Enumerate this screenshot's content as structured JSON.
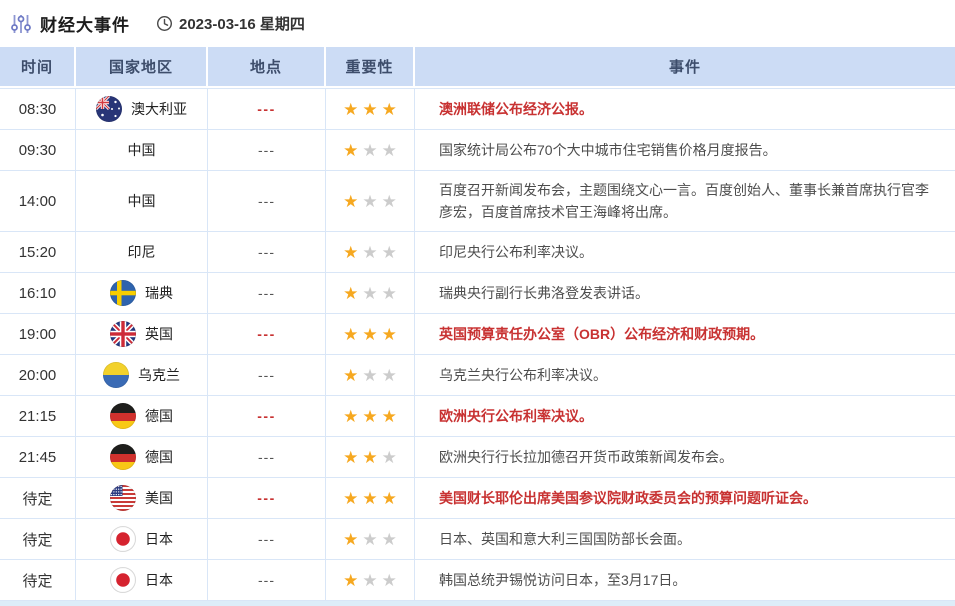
{
  "header": {
    "title": "财经大事件",
    "title_icon": "sliders-icon",
    "date_icon": "clock-icon",
    "date": "2023-03-16 星期四"
  },
  "table": {
    "columns": [
      "时间",
      "国家地区",
      "地点",
      "重要性",
      "事件"
    ],
    "max_stars": 3,
    "rows": [
      {
        "time": "08:30",
        "country": "澳大利亚",
        "flag": "australia",
        "location": "---",
        "stars": 3,
        "highlight": true,
        "event": "澳洲联储公布经济公报。"
      },
      {
        "time": "09:30",
        "country": "中国",
        "flag": null,
        "location": "---",
        "stars": 1,
        "highlight": false,
        "event": "国家统计局公布70个大中城市住宅销售价格月度报告。"
      },
      {
        "time": "14:00",
        "country": "中国",
        "flag": null,
        "location": "---",
        "stars": 1,
        "highlight": false,
        "event": "百度召开新闻发布会，主题围绕文心一言。百度创始人、董事长兼首席执行官李彦宏，百度首席技术官王海峰将出席。"
      },
      {
        "time": "15:20",
        "country": "印尼",
        "flag": null,
        "location": "---",
        "stars": 1,
        "highlight": false,
        "event": "印尼央行公布利率决议。"
      },
      {
        "time": "16:10",
        "country": "瑞典",
        "flag": "sweden",
        "location": "---",
        "stars": 1,
        "highlight": false,
        "event": "瑞典央行副行长弗洛登发表讲话。"
      },
      {
        "time": "19:00",
        "country": "英国",
        "flag": "uk",
        "location": "---",
        "stars": 3,
        "highlight": true,
        "event": "英国预算责任办公室（OBR）公布经济和财政预期。"
      },
      {
        "time": "20:00",
        "country": "乌克兰",
        "flag": "ukraine",
        "location": "---",
        "stars": 1,
        "highlight": false,
        "event": "乌克兰央行公布利率决议。"
      },
      {
        "time": "21:15",
        "country": "德国",
        "flag": "germany",
        "location": "---",
        "stars": 3,
        "highlight": true,
        "event": "欧洲央行公布利率决议。"
      },
      {
        "time": "21:45",
        "country": "德国",
        "flag": "germany",
        "location": "---",
        "stars": 2,
        "highlight": false,
        "event": "欧洲央行行长拉加德召开货币政策新闻发布会。"
      },
      {
        "time": "待定",
        "country": "美国",
        "flag": "usa",
        "location": "---",
        "stars": 3,
        "highlight": true,
        "event": "美国财长耶伦出席美国参议院财政委员会的预算问题听证会。"
      },
      {
        "time": "待定",
        "country": "日本",
        "flag": "japan",
        "location": "---",
        "stars": 1,
        "highlight": false,
        "event": "日本、英国和意大利三国国防部长会面。"
      },
      {
        "time": "待定",
        "country": "日本",
        "flag": "japan",
        "location": "---",
        "stars": 1,
        "highlight": false,
        "event": "韩国总统尹锡悦访问日本，至3月17日。"
      }
    ]
  },
  "colors": {
    "accent_red": "#c83232",
    "star_gold": "#f6a820",
    "star_gray": "#cccccc",
    "header_bg": "#ccdcf5",
    "header_text": "#3d4d6b",
    "border": "#d9e6f7",
    "icon_indigo": "#7d88cb"
  }
}
